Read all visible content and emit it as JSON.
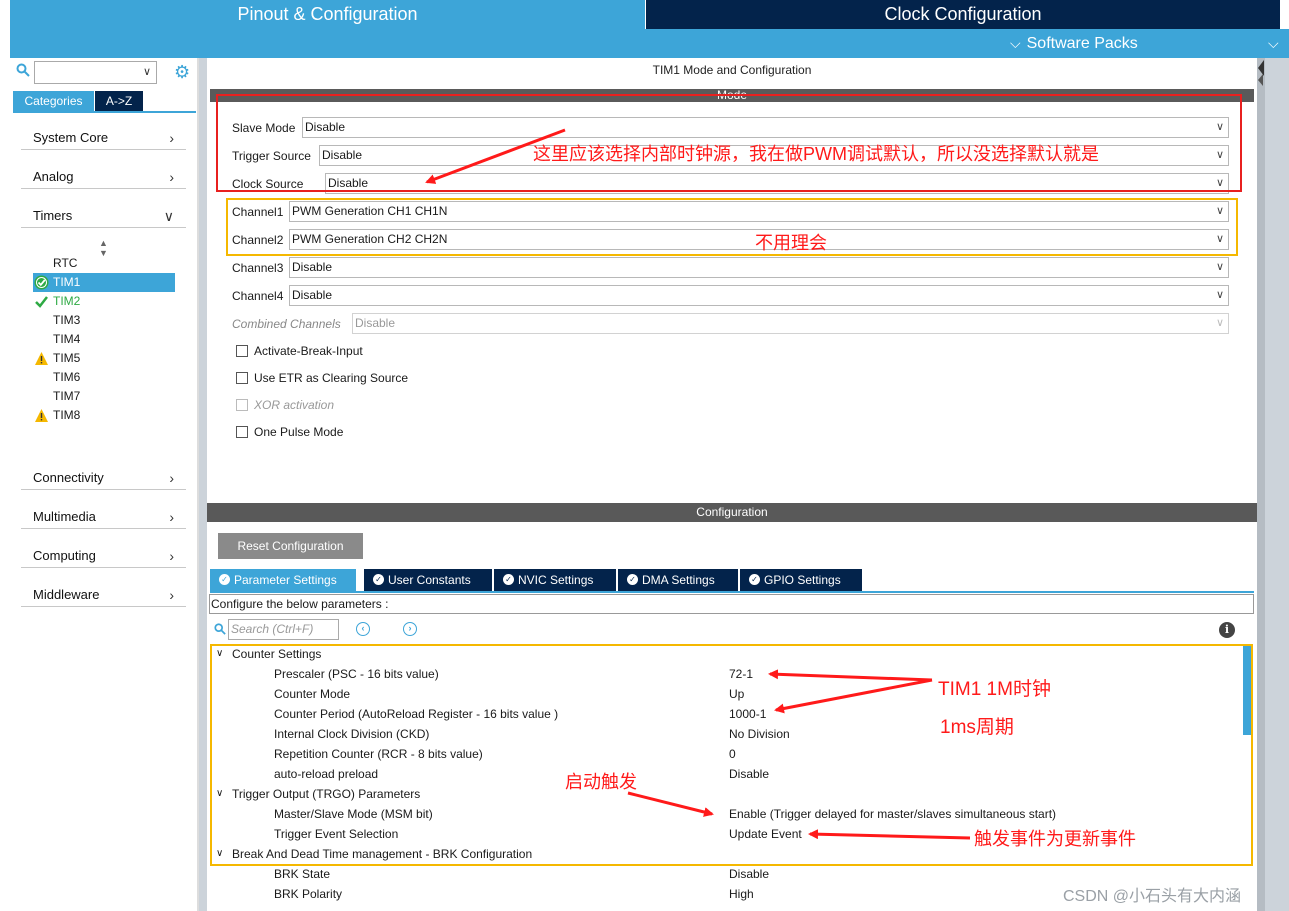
{
  "header": {
    "tab_pinout": "Pinout & Configuration",
    "tab_clock": "Clock Configuration",
    "software_packs": "Software Packs"
  },
  "sidebar": {
    "tab_categories": "Categories",
    "tab_az": "A->Z",
    "categories": [
      "System Core",
      "Analog",
      "Timers",
      "Connectivity",
      "Multimedia",
      "Computing",
      "Middleware"
    ],
    "timers": [
      {
        "label": "RTC",
        "state": "none"
      },
      {
        "label": "TIM1",
        "state": "selected-ok"
      },
      {
        "label": "TIM2",
        "state": "ok"
      },
      {
        "label": "TIM3",
        "state": "none"
      },
      {
        "label": "TIM4",
        "state": "none"
      },
      {
        "label": "TIM5",
        "state": "warning"
      },
      {
        "label": "TIM6",
        "state": "none"
      },
      {
        "label": "TIM7",
        "state": "none"
      },
      {
        "label": "TIM8",
        "state": "warning"
      }
    ]
  },
  "mode": {
    "title": "TIM1 Mode and Configuration",
    "section": "Mode",
    "fields": [
      {
        "label": "Slave Mode",
        "value": "Disable"
      },
      {
        "label": "Trigger Source",
        "value": "Disable"
      },
      {
        "label": "Clock Source",
        "value": "Disable"
      },
      {
        "label": "Channel1",
        "value": "PWM Generation CH1 CH1N"
      },
      {
        "label": "Channel2",
        "value": "PWM Generation CH2 CH2N"
      },
      {
        "label": "Channel3",
        "value": "Disable"
      },
      {
        "label": "Channel4",
        "value": "Disable"
      },
      {
        "label": "Combined Channels",
        "value": "Disable"
      }
    ],
    "checkboxes": [
      {
        "label": "Activate-Break-Input",
        "enabled": true
      },
      {
        "label": "Use ETR as Clearing Source",
        "enabled": true
      },
      {
        "label": "XOR activation",
        "enabled": false
      },
      {
        "label": "One Pulse Mode",
        "enabled": true
      }
    ]
  },
  "config": {
    "section": "Configuration",
    "reset_button": "Reset Configuration",
    "tabs": [
      "Parameter Settings",
      "User Constants",
      "NVIC Settings",
      "DMA Settings",
      "GPIO Settings"
    ],
    "configure_text": "Configure the below parameters :",
    "search_placeholder": "Search (Ctrl+F)",
    "groups": [
      {
        "label": "Counter Settings",
        "params": [
          {
            "label": "Prescaler (PSC - 16 bits value)",
            "value": "72-1"
          },
          {
            "label": "Counter Mode",
            "value": "Up"
          },
          {
            "label": "Counter Period (AutoReload Register - 16 bits value )",
            "value": "1000-1"
          },
          {
            "label": "Internal Clock Division (CKD)",
            "value": "No Division"
          },
          {
            "label": "Repetition Counter (RCR - 8 bits value)",
            "value": "0"
          },
          {
            "label": "auto-reload preload",
            "value": "Disable"
          }
        ]
      },
      {
        "label": "Trigger Output (TRGO) Parameters",
        "params": [
          {
            "label": "Master/Slave Mode (MSM bit)",
            "value": "Enable (Trigger delayed for master/slaves simultaneous start)"
          },
          {
            "label": "Trigger Event Selection",
            "value": "Update Event"
          }
        ]
      },
      {
        "label": "Break And Dead Time management - BRK Configuration",
        "params": [
          {
            "label": "BRK State",
            "value": "Disable"
          },
          {
            "label": "BRK Polarity",
            "value": "High"
          }
        ]
      }
    ]
  },
  "annotations": {
    "clock_note": "这里应该选择内部时钟源，我在做PWM调试默认，所以没选择默认就是",
    "channel_note": "不用理会",
    "tim1_clock": "TIM1 1M时钟",
    "period": "1ms周期",
    "start_trigger": "启动触发",
    "trigger_event": "触发事件为更新事件",
    "watermark": "CSDN @小石头有大内涵",
    "colors": {
      "red": "#ff1a1a",
      "orange": "#f5b800"
    }
  }
}
